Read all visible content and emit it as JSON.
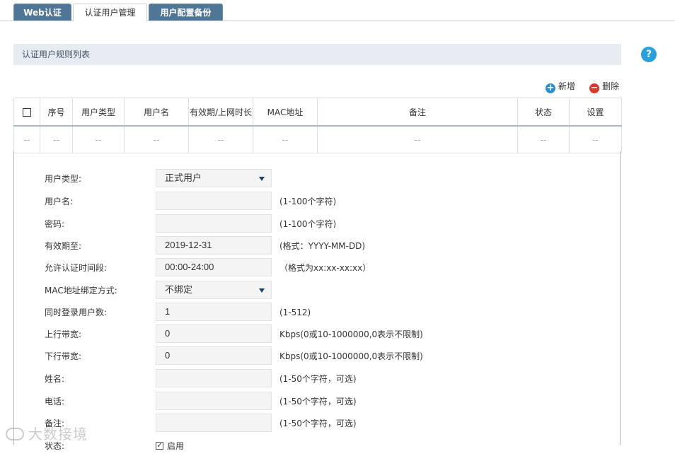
{
  "tabs": [
    {
      "label": "Web认证",
      "active": false
    },
    {
      "label": "认证用户管理",
      "active": true
    },
    {
      "label": "用户配置备份",
      "active": false
    }
  ],
  "section": {
    "title": "认证用户规则列表"
  },
  "help_label": "?",
  "toolbar": {
    "add_label": "新增",
    "delete_label": "删除"
  },
  "table": {
    "headers": [
      "序号",
      "用户类型",
      "用户名",
      "有效期/上网时长",
      "MAC地址",
      "备注",
      "状态",
      "设置"
    ],
    "empty_cell": "--"
  },
  "form": {
    "user_type": {
      "label": "用户类型:",
      "value": "正式用户"
    },
    "username": {
      "label": "用户名:",
      "value": "",
      "hint": "(1-100个字符)"
    },
    "password": {
      "label": "密码:",
      "value": "",
      "hint": "(1-100个字符)"
    },
    "expiry": {
      "label": "有效期至:",
      "value": "2019-12-31",
      "hint": "(格式：YYYY-MM-DD)"
    },
    "allowed_time": {
      "label": "允许认证时间段:",
      "value": "00:00-24:00",
      "hint": "（格式为xx:xx-xx:xx）"
    },
    "mac_binding": {
      "label": "MAC地址绑定方式:",
      "value": "不绑定"
    },
    "concurrent_users": {
      "label": "同时登录用户数:",
      "value": "1",
      "hint": "(1-512)"
    },
    "upload_bw": {
      "label": "上行带宽:",
      "value": "0",
      "hint": "Kbps(0或10-1000000,0表示不限制)"
    },
    "download_bw": {
      "label": "下行带宽:",
      "value": "0",
      "hint": "Kbps(0或10-1000000,0表示不限制)"
    },
    "name": {
      "label": "姓名:",
      "value": "",
      "hint": "(1-50个字符，可选)"
    },
    "phone": {
      "label": "电话:",
      "value": "",
      "hint": "(1-50个字符，可选)"
    },
    "remark": {
      "label": "备注:",
      "value": "",
      "hint": "(1-50个字符，可选)"
    },
    "status": {
      "label": "状态:",
      "enable_label": "启用",
      "checked": true
    }
  },
  "watermark": "大数接境",
  "colors": {
    "tab_active": "#4f7597",
    "add": "#2a8fd0",
    "delete": "#d9382d",
    "help": "#27a0dd"
  }
}
